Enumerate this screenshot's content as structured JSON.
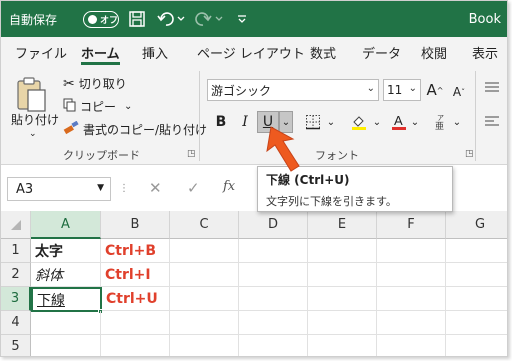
{
  "titlebar": {
    "autosave_label": "自動保存",
    "autosave_state": "オフ",
    "book_title": "Book"
  },
  "tabs": [
    "ファイル",
    "ホーム",
    "挿入",
    "ページ レイアウト",
    "数式",
    "データ",
    "校閲",
    "表示"
  ],
  "active_tab": "ホーム",
  "clipboard": {
    "paste_label": "貼り付け",
    "cut_label": "切り取り",
    "copy_label": "コピー",
    "format_painter_label": "書式のコピー/貼り付け",
    "group_label": "クリップボード"
  },
  "font": {
    "font_name": "游ゴシック",
    "font_size": "11",
    "group_label": "フォント",
    "bold_label": "B",
    "italic_label": "I",
    "underline_label": "U",
    "grow_label": "A",
    "shrink_label": "A"
  },
  "formula_bar": {
    "name_box": "A3",
    "fx_label": "fx"
  },
  "tooltip": {
    "title": "下線 (Ctrl+U)",
    "description": "文字列に下線を引きます。"
  },
  "sheet": {
    "columns": [
      "A",
      "B",
      "C",
      "D",
      "E",
      "F",
      "G"
    ],
    "rows": [
      "1",
      "2",
      "3",
      "4",
      "5"
    ],
    "cells": {
      "A1": "太字",
      "B1": "Ctrl+B",
      "A2": "斜体",
      "B2": "Ctrl+I",
      "A3": "下線",
      "B3": "Ctrl+U"
    }
  },
  "colors": {
    "excel_green": "#217346",
    "shortcut_red": "#e0402c",
    "pointer_orange": "#ee5a1f"
  }
}
